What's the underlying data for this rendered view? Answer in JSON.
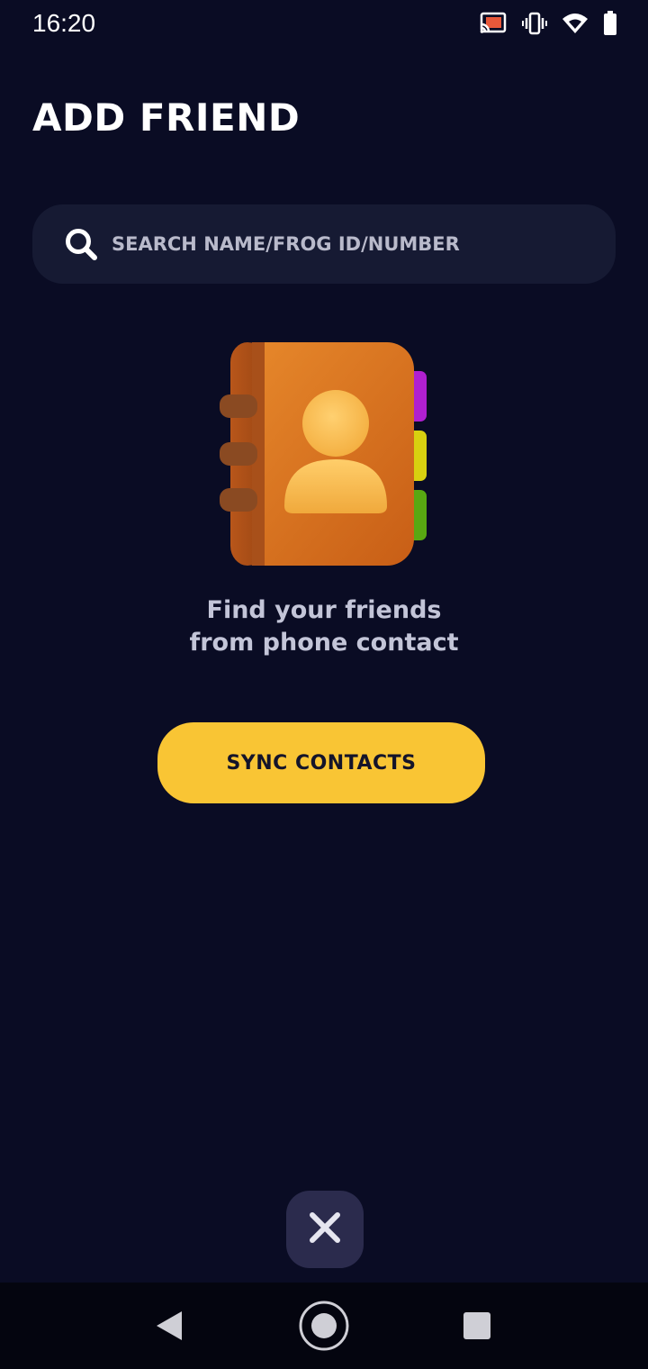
{
  "status_bar": {
    "time": "16:20",
    "icons": [
      "cast-icon",
      "vibrate-icon",
      "wifi-icon",
      "battery-icon"
    ]
  },
  "header": {
    "title": "ADD FRIEND"
  },
  "search": {
    "placeholder": "SEARCH NAME/FROG ID/NUMBER",
    "value": "",
    "icon": "search-icon"
  },
  "empty_state": {
    "illustration": "contacts-book-icon",
    "line1": "Find your friends",
    "line2": "from phone contact"
  },
  "actions": {
    "sync_label": "SYNC CONTACTS",
    "close_icon": "close-icon"
  },
  "nav_bar": {
    "icons": [
      "back-icon",
      "home-icon",
      "recents-icon"
    ]
  },
  "colors": {
    "background": "#0a0c24",
    "search_bg": "#161a33",
    "accent": "#f9c534",
    "close_bg": "#2b2b4d",
    "text_muted": "#c3c5d8"
  }
}
